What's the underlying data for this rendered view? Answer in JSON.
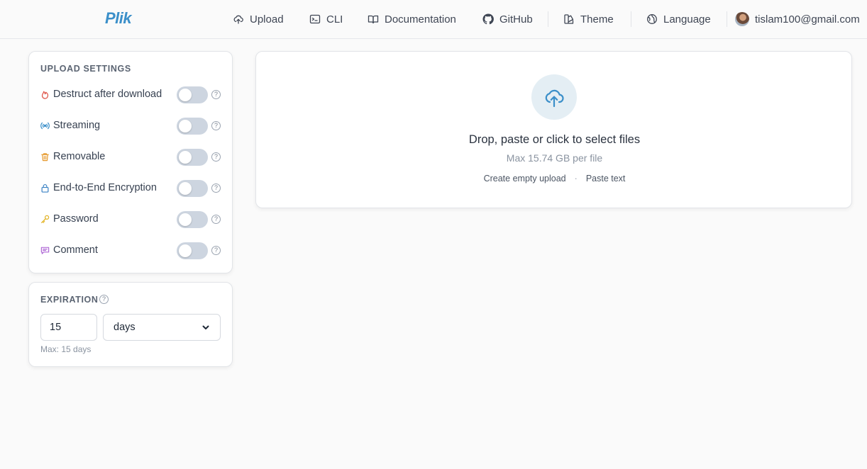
{
  "app": {
    "name": "Plik"
  },
  "nav": {
    "upload": "Upload",
    "cli": "CLI",
    "documentation": "Documentation",
    "github": "GitHub",
    "theme": "Theme",
    "language": "Language",
    "user_email": "tislam100@gmail.com"
  },
  "upload_settings": {
    "title": "UPLOAD SETTINGS",
    "items": [
      {
        "label": "Destruct after download",
        "icon": "flame-icon",
        "enabled": false
      },
      {
        "label": "Streaming",
        "icon": "broadcast-icon",
        "enabled": false
      },
      {
        "label": "Removable",
        "icon": "trash-icon",
        "enabled": false
      },
      {
        "label": "End-to-End Encryption",
        "icon": "lock-icon",
        "enabled": false
      },
      {
        "label": "Password",
        "icon": "key-icon",
        "enabled": false
      },
      {
        "label": "Comment",
        "icon": "comment-icon",
        "enabled": false
      }
    ]
  },
  "expiration": {
    "title": "EXPIRATION",
    "value": "15",
    "unit": "days",
    "note": "Max: 15 days"
  },
  "dropzone": {
    "title": "Drop, paste or click to select files",
    "subtitle": "Max 15.74 GB per file",
    "action_empty": "Create empty upload",
    "separator": "·",
    "action_paste": "Paste text"
  },
  "colors": {
    "brand": "#3b8fc9",
    "icon_destruct": "#e05a4f",
    "icon_streaming": "#3b8fc9",
    "icon_removable": "#e69a2e",
    "icon_encryption": "#3b82c4",
    "icon_password": "#e3b52a",
    "icon_comment": "#b06ad6"
  }
}
